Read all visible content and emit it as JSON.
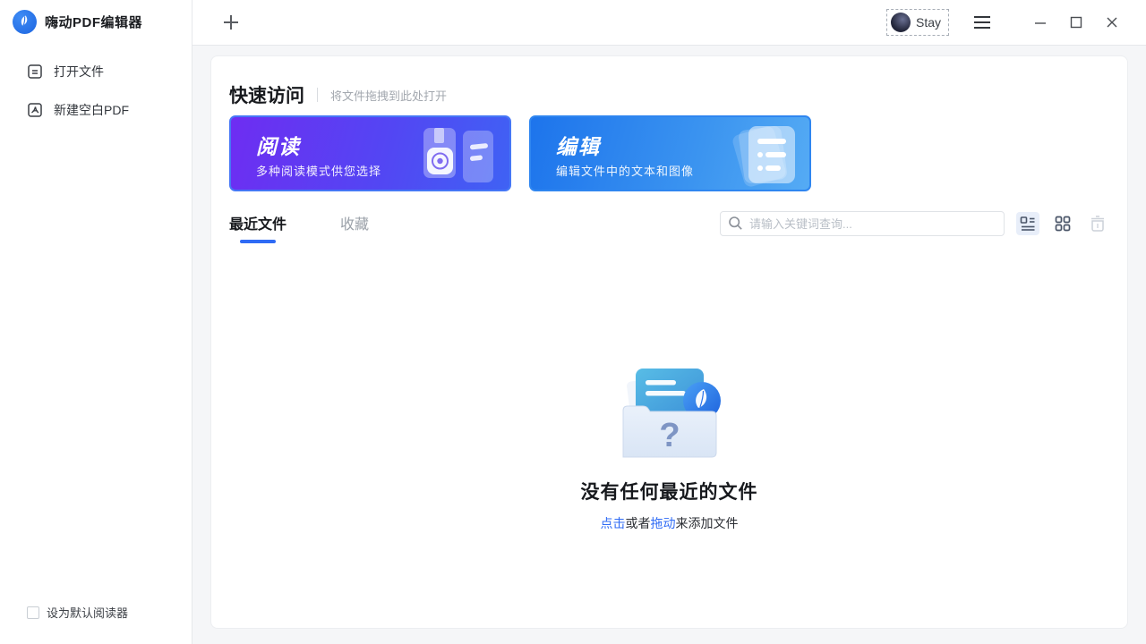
{
  "app": {
    "name": "嗨动PDF编辑器"
  },
  "sidebar": {
    "items": [
      {
        "label": "打开文件"
      },
      {
        "label": "新建空白PDF"
      }
    ],
    "default_reader": {
      "label": "设为默认阅读器",
      "checked": false
    }
  },
  "titlebar": {
    "user": {
      "label": "Stay"
    }
  },
  "quick_access": {
    "title": "快速访问",
    "hint": "将文件拖拽到此处打开",
    "cards": [
      {
        "title": "阅读",
        "subtitle": "多种阅读模式供您选择",
        "gradient_from": "#6e2df2",
        "gradient_to": "#3f62f4",
        "border_color": "#4677f6"
      },
      {
        "title": "编辑",
        "subtitle": "编辑文件中的文本和图像",
        "gradient_from": "#1d74ec",
        "gradient_to": "#55abf4",
        "border_color": "#2f86f0"
      }
    ]
  },
  "file_section": {
    "tabs": [
      {
        "label": "最近文件",
        "active": true
      },
      {
        "label": "收藏",
        "active": false
      }
    ],
    "search": {
      "placeholder": "请输入关键词查询...",
      "value": ""
    },
    "view_controls": [
      {
        "name": "list-view",
        "active": true
      },
      {
        "name": "grid-view",
        "active": false
      },
      {
        "name": "trash",
        "disabled": true
      }
    ],
    "empty_state": {
      "title": "没有任何最近的文件",
      "click_link": "点击",
      "middle_text": "或者",
      "drag_link": "拖动",
      "suffix_text": "来添加文件"
    }
  },
  "colors": {
    "accent": "#2f6bf5",
    "link": "#2f6bf5",
    "tab_underline": "#2f6bf5",
    "main_background": "#f5f6f8"
  }
}
